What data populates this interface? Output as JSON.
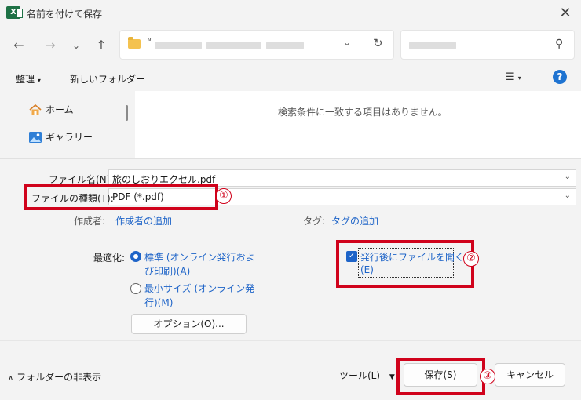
{
  "window": {
    "title": "名前を付けて保存",
    "app_logo": "X"
  },
  "icons": {
    "close": "close-icon",
    "back": "back-arrow-icon",
    "forward": "forward-arrow-icon",
    "recent": "chevron-down-icon",
    "up": "up-arrow-icon",
    "refresh": "refresh-icon",
    "search": "search-icon",
    "help": "help-icon"
  },
  "address": {
    "prefix": "“"
  },
  "toolbar": {
    "organize": "整理",
    "new_folder": "新しいフォルダー"
  },
  "nav": {
    "items": [
      {
        "label": "ホーム",
        "icon": "home-icon"
      },
      {
        "label": "ギャラリー",
        "icon": "gallery-icon"
      }
    ]
  },
  "content": {
    "empty_message": "検索条件に一致する項目はありません。"
  },
  "form": {
    "filename_label": "ファイル名(N):",
    "filename_value": "旅のしおりエクセル.pdf",
    "filetype_label": "ファイルの種類(T):",
    "filetype_value": "PDF (*.pdf)",
    "author_label": "作成者:",
    "author_link": "作成者の追加",
    "tag_label": "タグ:",
    "tag_link": "タグの追加",
    "optimize_label": "最適化:",
    "opt_standard_line1": "標準 (オンライン発行およ",
    "opt_standard_line2": "び印刷)(A)",
    "opt_min_line1": "最小サイズ (オンライン発",
    "opt_min_line2": "行)(M)",
    "options_button": "オプション(O)...",
    "open_after_line1": "発行後にファイルを開く",
    "open_after_line2": "(E)",
    "open_after_checked": true
  },
  "annotations": {
    "badge1": "①",
    "badge2": "②",
    "badge3": "③",
    "color": "#d0021b"
  },
  "footer": {
    "hide_folders": "フォルダーの非表示",
    "tools": "ツール(L)",
    "save": "保存(S)",
    "cancel": "キャンセル"
  },
  "colors": {
    "accent": "#1e64c8",
    "excel_green": "#1e7145"
  }
}
